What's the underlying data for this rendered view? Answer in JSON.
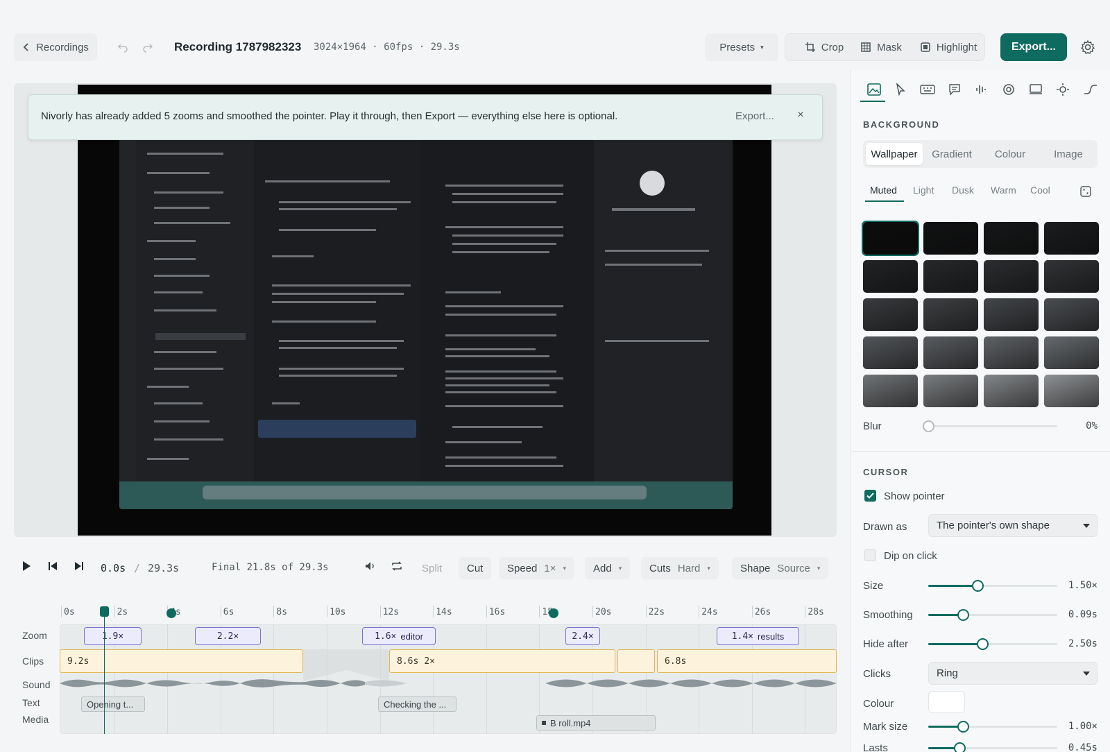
{
  "header": {
    "back_label": "Recordings",
    "title": "Recording 1787982323",
    "meta": "3024×1964 · 60fps · 29.3s",
    "presets_label": "Presets",
    "crop_label": "Crop",
    "mask_label": "Mask",
    "highlight_label": "Highlight",
    "export_label": "Export..."
  },
  "banner": {
    "message": "Nivorly has already added 5 zooms and smoothed the pointer. Play it through, then Export — everything else here is optional.",
    "export_label": "Export...",
    "close": "×"
  },
  "transport": {
    "current_time": "0.0s",
    "separator": "/",
    "total_time": "29.3s",
    "final_info": "Final 21.8s of 29.3s",
    "split_label": "Split",
    "cut_label": "Cut",
    "speed_label": "Speed",
    "speed_value": "1×",
    "add_label": "Add",
    "cuts_label": "Cuts",
    "cuts_value": "Hard",
    "shape_label": "Shape",
    "shape_value": "Source"
  },
  "timeline": {
    "ruler": [
      "0s",
      "2s",
      "4s",
      "6s",
      "8s",
      "10s",
      "12s",
      "14s",
      "16s",
      "18s",
      "20s",
      "22s",
      "24s",
      "26s",
      "28s"
    ],
    "row_labels": {
      "zoom": "Zoom",
      "clips": "Clips",
      "sound": "Sound",
      "text": "Text",
      "media": "Media"
    },
    "zooms": [
      {
        "value": "1.9×",
        "name": ""
      },
      {
        "value": "2.2×",
        "name": ""
      },
      {
        "value": "1.6×",
        "name": "editor"
      },
      {
        "value": "2.4×",
        "name": ""
      },
      {
        "value": "1.4×",
        "name": "results"
      }
    ],
    "clips": [
      {
        "duration": "9.2s",
        "speed": ""
      },
      {
        "duration": "8.6s",
        "speed": "2×"
      },
      {
        "duration": "",
        "speed": ""
      },
      {
        "duration": "6.8s",
        "speed": ""
      }
    ],
    "texts": [
      "Opening t...",
      "Checking the ..."
    ],
    "media": [
      "B roll.mp4"
    ],
    "playhead_time": "0.0s"
  },
  "panel": {
    "background": {
      "heading": "BACKGROUND",
      "tabs": [
        "Wallpaper",
        "Gradient",
        "Colour",
        "Image"
      ],
      "active_tab": "Wallpaper",
      "subtabs": [
        "Muted",
        "Light",
        "Dusk",
        "Warm",
        "Cool"
      ],
      "active_subtab": "Muted",
      "blur_label": "Blur",
      "blur_value": "0%",
      "blur_level": 0
    },
    "cursor": {
      "heading": "CURSOR",
      "show_pointer_label": "Show pointer",
      "show_pointer": true,
      "drawn_as_label": "Drawn as",
      "drawn_as_value": "The pointer's own shape",
      "dip_label": "Dip on click",
      "dip": false,
      "size_label": "Size",
      "size_value": "1.50×",
      "size_level": 0.38,
      "smoothing_label": "Smoothing",
      "smoothing_value": "0.09s",
      "smoothing_level": 0.27,
      "hide_label": "Hide after",
      "hide_value": "2.50s",
      "hide_level": 0.42,
      "clicks_label": "Clicks",
      "clicks_value": "Ring",
      "colour_label": "Colour",
      "colour_value": "#ffffff",
      "mark_label": "Mark size",
      "mark_value": "1.00×",
      "mark_level": 0.27,
      "lasts_label": "Lasts",
      "lasts_value": "0.45s",
      "lasts_level": 0.24
    }
  },
  "colors": {
    "accent": "#0d6b60",
    "zoom": "#7d6fd2",
    "clip": "#e2b756"
  }
}
